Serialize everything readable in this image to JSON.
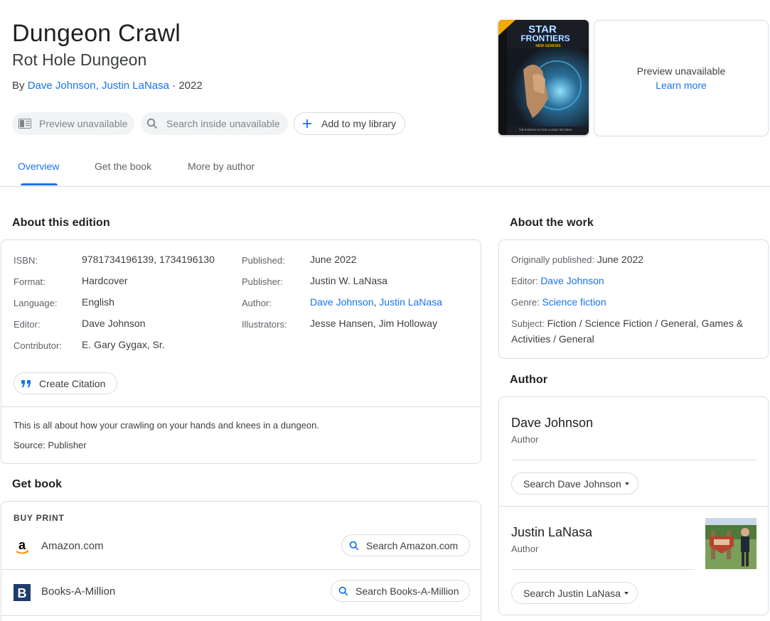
{
  "book": {
    "title": "Dungeon Crawl",
    "subtitle": "Rot Hole Dungeon",
    "by_prefix": "By ",
    "author1": "Dave Johnson",
    "author_sep": ", ",
    "author2": "Justin LaNasa",
    "year_sep": " · ",
    "year": "2022"
  },
  "actions": {
    "preview": "Preview unavailable",
    "search_inside": "Search inside unavailable",
    "add_library": "Add to my library"
  },
  "cover": {
    "line1": "STAR",
    "line2": "FRONTIERS",
    "line3": "NEW GENESIS",
    "footer": "THE SCIENCE FICTION CLASSIC RETURNS"
  },
  "preview_box": {
    "text": "Preview unavailable",
    "link": "Learn more"
  },
  "tabs": [
    "Overview",
    "Get the book",
    "More by author"
  ],
  "edition": {
    "heading": "About this edition",
    "left": [
      {
        "k": "ISBN:",
        "v": "9781734196139, 1734196130"
      },
      {
        "k": "Format:",
        "v": "Hardcover"
      },
      {
        "k": "Language:",
        "v": "English"
      },
      {
        "k": "Editor:",
        "v": "Dave Johnson"
      },
      {
        "k": "Contributor:",
        "v": "E. Gary Gygax, Sr."
      }
    ],
    "right": [
      {
        "k": "Published:",
        "v": "June 2022"
      },
      {
        "k": "Publisher:",
        "v": "Justin W. LaNasa"
      },
      {
        "k": "Author:",
        "v1": "Dave Johnson",
        "sep": ", ",
        "v2": "Justin LaNasa"
      },
      {
        "k": "Illustrators:",
        "v": "Jesse Hansen, Jim Holloway"
      }
    ],
    "citation": "Create Citation",
    "description": "This is all about how your crawling on your hands and knees in a dungeon.",
    "source": "Source: Publisher"
  },
  "get_book": {
    "heading": "Get book",
    "buy_print": "BUY PRINT",
    "stores": [
      {
        "name": "Amazon.com",
        "button": "Search Amazon.com"
      },
      {
        "name": "Books-A-Million",
        "button": "Search Books-A-Million"
      }
    ]
  },
  "work": {
    "heading": "About the work",
    "orig_label": "Originally published: ",
    "orig_value": "June 2022",
    "editor_label": "Editor: ",
    "editor_value": "Dave Johnson",
    "genre_label": "Genre: ",
    "genre_value": "Science fiction",
    "subject_label": "Subject: ",
    "subject_line1": "Fiction / Science Fiction / General, Games &",
    "subject_line2": "Activities / General"
  },
  "authors": {
    "heading": "Author",
    "list": [
      {
        "name": "Dave Johnson",
        "role": "Author",
        "search": "Search Dave Johnson"
      },
      {
        "name": "Justin LaNasa",
        "role": "Author",
        "search": "Search Justin LaNasa"
      }
    ]
  },
  "colors": {
    "link": "#1a73e8",
    "text": "#202124",
    "border": "#dadce0"
  }
}
